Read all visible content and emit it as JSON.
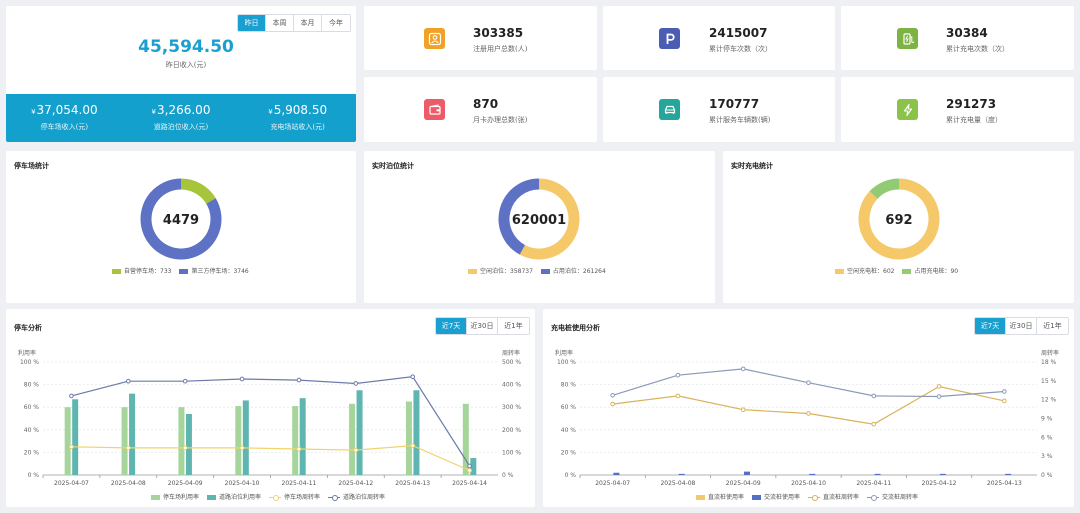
{
  "revenue": {
    "tabs": [
      "昨日",
      "本周",
      "本月",
      "今年"
    ],
    "active_tab": 0,
    "amount": "45,594.50",
    "label": "昨日收入(元)",
    "currency": "¥",
    "subs": [
      {
        "amount": "37,054.00",
        "label": "停车场收入(元)"
      },
      {
        "amount": "3,266.00",
        "label": "道路泊位收入(元)"
      },
      {
        "amount": "5,908.50",
        "label": "充电场站收入(元)"
      }
    ]
  },
  "stats": [
    {
      "value": "303385",
      "label": "注册用户总数(人)",
      "icon": "user-icon",
      "color": "#f0a126"
    },
    {
      "value": "2415007",
      "label": "累计停车次数（次）",
      "icon": "parking-icon",
      "color": "#4a5db3"
    },
    {
      "value": "30384",
      "label": "累计充电次数（次）",
      "icon": "charging-pile-icon",
      "color": "#7cb342"
    },
    {
      "value": "870",
      "label": "月卡办理总数(张)",
      "icon": "wallet-icon",
      "color": "#ec5b67"
    },
    {
      "value": "170777",
      "label": "累计服务车辆数(辆)",
      "icon": "car-icon",
      "color": "#26a69a"
    },
    {
      "value": "291273",
      "label": "累计充电量（度）",
      "icon": "lightning-icon",
      "color": "#8bc34a"
    }
  ],
  "donuts": [
    {
      "title": "停车场统计",
      "total": "4479",
      "segments": [
        {
          "label": "自营停车场：733",
          "value": 733,
          "color": "#a6c53a"
        },
        {
          "label": "第三方停车场：3746",
          "value": 3746,
          "color": "#5d72c4"
        }
      ]
    },
    {
      "title": "实时泊位统计",
      "total": "620001",
      "segments": [
        {
          "label": "空闲泊位：358737",
          "value": 358737,
          "color": "#f5c96a"
        },
        {
          "label": "占用泊位：261264",
          "value": 261264,
          "color": "#5d72c4"
        }
      ]
    },
    {
      "title": "实时充电统计",
      "total": "692",
      "segments": [
        {
          "label": "空闲充电桩：602",
          "value": 602,
          "color": "#f5c96a"
        },
        {
          "label": "占用充电桩：90",
          "value": 90,
          "color": "#91cc75"
        }
      ]
    }
  ],
  "chart_data": [
    {
      "type": "bar",
      "title": "停车分析",
      "tabs": [
        "近7天",
        "近30日",
        "近1年"
      ],
      "active_tab": 0,
      "y_left_label": "利用率",
      "y_right_label": "周转率",
      "y_left_ticks": [
        "0 %",
        "20 %",
        "40 %",
        "60 %",
        "80 %",
        "100 %"
      ],
      "y_right_ticks": [
        "0 %",
        "100 %",
        "200 %",
        "300 %",
        "400 %",
        "500 %"
      ],
      "ylim_left": [
        0,
        100
      ],
      "ylim_right": [
        0,
        500
      ],
      "categories": [
        "2025-04-07",
        "2025-04-08",
        "2025-04-09",
        "2025-04-10",
        "2025-04-11",
        "2025-04-12",
        "2025-04-13",
        "2025-04-14"
      ],
      "series": [
        {
          "name": "停车场利用率",
          "type": "bar",
          "axis": "left",
          "color": "#a5d59a",
          "values": [
            60,
            60,
            60,
            61,
            61,
            63,
            65,
            63
          ]
        },
        {
          "name": "道路泊位利用率",
          "type": "bar",
          "axis": "left",
          "color": "#5fb5b0",
          "values": [
            67,
            72,
            54,
            66,
            68,
            75,
            75,
            15
          ]
        },
        {
          "name": "停车场周转率",
          "type": "line",
          "axis": "right",
          "color": "#f2d36b",
          "values": [
            125,
            120,
            120,
            120,
            115,
            110,
            130,
            20
          ]
        },
        {
          "name": "道路泊位周转率",
          "type": "line",
          "axis": "right",
          "color": "#6b7aa8",
          "values": [
            350,
            415,
            415,
            425,
            420,
            405,
            435,
            40
          ]
        }
      ]
    },
    {
      "type": "bar",
      "title": "充电桩使用分析",
      "tabs": [
        "近7天",
        "近30日",
        "近1年"
      ],
      "active_tab": 0,
      "y_left_label": "利用率",
      "y_right_label": "周转率",
      "y_left_ticks": [
        "0 %",
        "20 %",
        "40 %",
        "60 %",
        "80 %",
        "100 %"
      ],
      "y_right_ticks": [
        "0 %",
        "3 %",
        "6 %",
        "9 %",
        "12 %",
        "15 %",
        "18 %"
      ],
      "ylim_left": [
        0,
        100
      ],
      "ylim_right": [
        0,
        18
      ],
      "categories": [
        "2025-04-07",
        "2025-04-08",
        "2025-04-09",
        "2025-04-10",
        "2025-04-11",
        "2025-04-12",
        "2025-04-13"
      ],
      "series": [
        {
          "name": "直流桩使用率",
          "type": "bar",
          "axis": "left",
          "color": "#f5c96a",
          "values": [
            0,
            0,
            0,
            0,
            0,
            0,
            0
          ]
        },
        {
          "name": "交流桩使用率",
          "type": "bar",
          "axis": "left",
          "color": "#5470c6",
          "values": [
            2,
            1,
            3,
            1,
            1,
            1,
            1
          ]
        },
        {
          "name": "直流桩周转率",
          "type": "line",
          "axis": "right",
          "color": "#d9b25a",
          "values": [
            11.3,
            12.6,
            10.4,
            9.8,
            8.1,
            14.1,
            11.8
          ]
        },
        {
          "name": "交流桩周转率",
          "type": "line",
          "axis": "right",
          "color": "#8a9bb8",
          "values": [
            12.7,
            15.9,
            16.9,
            14.7,
            12.6,
            12.5,
            13.3
          ]
        }
      ]
    }
  ]
}
